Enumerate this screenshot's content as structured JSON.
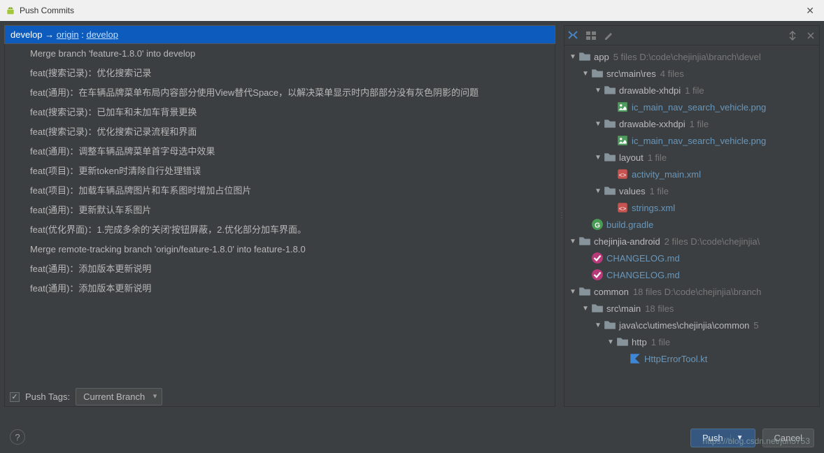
{
  "window": {
    "title": "Push Commits"
  },
  "branch": {
    "local": "develop",
    "arrow": "→",
    "remote": "origin",
    "sep": ":",
    "target": "develop"
  },
  "commits": [
    "Merge branch 'feature-1.8.0' into develop",
    "feat(搜索记录)：优化搜索记录",
    "feat(通用)：在车辆品牌菜单布局内容部分使用View替代Space，以解决菜单显示时内部部分没有灰色阴影的问题",
    "feat(搜索记录)：已加车和未加车背景更换",
    "feat(搜索记录)：优化搜索记录流程和界面",
    "feat(通用)：调整车辆品牌菜单首字母选中效果",
    "feat(项目)：更新token时清除自行处理错误",
    "feat(项目)：加载车辆品牌图片和车系图时增加占位图片",
    "feat(通用)：更新默认车系图片",
    "feat(优化界面)：1.完成多余的'关闭'按钮屏蔽，2.优化部分加车界面。",
    "Merge remote-tracking branch 'origin/feature-1.8.0' into feature-1.8.0",
    "feat(通用)：添加版本更新说明",
    "feat(通用)：添加版本更新说明"
  ],
  "tree": {
    "app": {
      "label": "app",
      "meta": "5 files  D:\\code\\chejinjia\\branch\\devel"
    },
    "src_main_res": {
      "label": "src\\main\\res",
      "meta": "4 files"
    },
    "drawable_xhdpi": {
      "label": "drawable-xhdpi",
      "meta": "1 file"
    },
    "png1": {
      "label": "ic_main_nav_search_vehicle.png"
    },
    "drawable_xxhdpi": {
      "label": "drawable-xxhdpi",
      "meta": "1 file"
    },
    "png2": {
      "label": "ic_main_nav_search_vehicle.png"
    },
    "layout": {
      "label": "layout",
      "meta": "1 file"
    },
    "activity_main": {
      "label": "activity_main.xml"
    },
    "values": {
      "label": "values",
      "meta": "1 file"
    },
    "strings": {
      "label": "strings.xml"
    },
    "build_gradle": {
      "label": "build.gradle"
    },
    "chejinjia_android": {
      "label": "chejinjia-android",
      "meta": "2 files  D:\\code\\chejinjia\\"
    },
    "changelog1": {
      "label": "CHANGELOG.md"
    },
    "changelog2": {
      "label": "CHANGELOG.md"
    },
    "common": {
      "label": "common",
      "meta": "18 files  D:\\code\\chejinjia\\branch"
    },
    "src_main2": {
      "label": "src\\main",
      "meta": "18 files"
    },
    "java_pkg": {
      "label": "java\\cc\\utimes\\chejinjia\\common",
      "meta": "5"
    },
    "http": {
      "label": "http",
      "meta": "1 file"
    },
    "http_tool": {
      "label": "HttpErrorTool.kt"
    }
  },
  "footer": {
    "push_tags": "Push Tags:",
    "current_branch": "Current Branch",
    "push": "Push",
    "cancel": "Cancel"
  },
  "watermark": "https://blog.csdn.net/jun5753"
}
